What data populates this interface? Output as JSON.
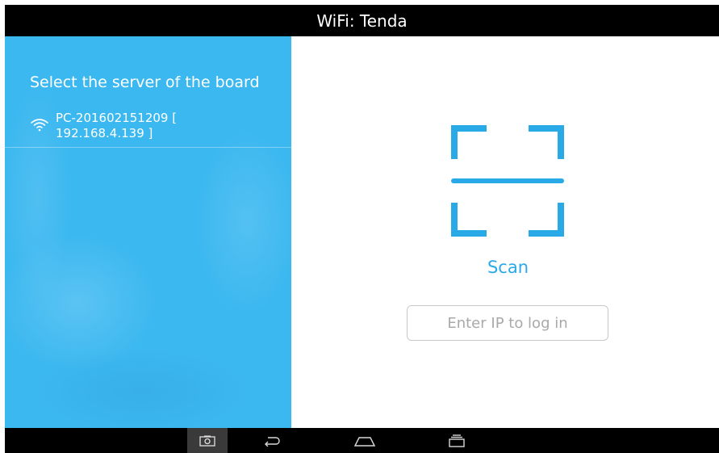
{
  "titlebar": {
    "title": "WiFi: Tenda"
  },
  "left_panel": {
    "heading": "Select the server of the board",
    "servers": [
      {
        "name_line": "PC-201602151209  [",
        "ip_line": "192.168.4.139 ]",
        "icon": "wifi-icon"
      }
    ]
  },
  "right_panel": {
    "scan_label": "Scan",
    "ip_input": {
      "placeholder": "Enter IP to log in",
      "value": ""
    }
  },
  "navbar": {
    "buttons": [
      "screenshot-icon",
      "back-icon",
      "home-icon",
      "recents-icon"
    ]
  },
  "colors": {
    "accent": "#29a9e6",
    "left_panel_bg": "#3cb8f0",
    "bar_bg": "#000000"
  }
}
